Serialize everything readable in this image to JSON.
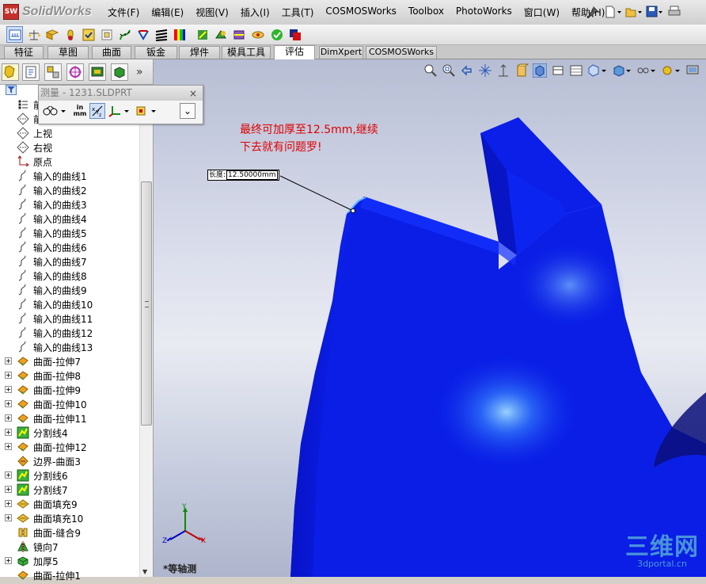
{
  "app": {
    "logo_badge": "SW",
    "logo_text": "SolidWorks"
  },
  "menu": [
    "文件(F)",
    "编辑(E)",
    "视图(V)",
    "插入(I)",
    "工具(T)",
    "COSMOSWorks",
    "Toolbox",
    "PhotoWorks",
    "窗口(W)",
    "帮助(H)"
  ],
  "menu_tools": [
    "pushpin-icon",
    "new-document-icon",
    "open-folder-icon",
    "save-icon",
    "print-icon"
  ],
  "command_toolbar": {
    "buttons": [
      "measure-icon",
      "mass-properties-icon",
      "section-properties-icon",
      "sensor-icon",
      "check-icon",
      "geometry-analysis-icon",
      "curvature-icon",
      "deviation-analysis-icon",
      "zebra-stripes-icon",
      "curvature-color-icon",
      "draft-analysis-icon",
      "undercut-icon",
      "parting-line-icon",
      "thickness-analysis-icon",
      "compare-icon",
      "error-icon"
    ],
    "active_index": 0
  },
  "tabs": [
    {
      "label": "特征",
      "selected": false
    },
    {
      "label": "草图",
      "selected": false
    },
    {
      "label": "曲面",
      "selected": false
    },
    {
      "label": "钣金",
      "selected": false
    },
    {
      "label": "焊件",
      "selected": false
    },
    {
      "label": "模具工具",
      "selected": false
    },
    {
      "label": "评估",
      "selected": true
    },
    {
      "label": "DimXpert",
      "selected": false
    },
    {
      "label": "COSMOSWorks",
      "selected": false
    }
  ],
  "panel_tabs": [
    "feature-manager-icon",
    "property-manager-icon",
    "configuration-manager-icon",
    "dimxpert-manager-icon",
    "display-manager-icon",
    "appearance-icon",
    "more-chevron-icon"
  ],
  "panel_more": "»",
  "tree": [
    {
      "label": "前",
      "icon": "sensor-folder-icon",
      "expand": false
    },
    {
      "label": "前视",
      "icon": "plane-icon",
      "expand": false
    },
    {
      "label": "上视",
      "icon": "plane-icon",
      "expand": false
    },
    {
      "label": "右视",
      "icon": "plane-icon",
      "expand": false
    },
    {
      "label": "原点",
      "icon": "origin-icon",
      "expand": false
    },
    {
      "label": "输入的曲线1",
      "icon": "curve-icon",
      "expand": false
    },
    {
      "label": "输入的曲线2",
      "icon": "curve-icon",
      "expand": false
    },
    {
      "label": "输入的曲线3",
      "icon": "curve-icon",
      "expand": false
    },
    {
      "label": "输入的曲线4",
      "icon": "curve-icon",
      "expand": false
    },
    {
      "label": "输入的曲线5",
      "icon": "curve-icon",
      "expand": false
    },
    {
      "label": "输入的曲线6",
      "icon": "curve-icon",
      "expand": false
    },
    {
      "label": "输入的曲线7",
      "icon": "curve-icon",
      "expand": false
    },
    {
      "label": "输入的曲线8",
      "icon": "curve-icon",
      "expand": false
    },
    {
      "label": "输入的曲线9",
      "icon": "curve-icon",
      "expand": false
    },
    {
      "label": "输入的曲线10",
      "icon": "curve-icon",
      "expand": false
    },
    {
      "label": "输入的曲线11",
      "icon": "curve-icon",
      "expand": false
    },
    {
      "label": "输入的曲线12",
      "icon": "curve-icon",
      "expand": false
    },
    {
      "label": "输入的曲线13",
      "icon": "curve-icon",
      "expand": false
    },
    {
      "label": "曲面-拉伸7",
      "icon": "surface-extrude-icon",
      "expand": true
    },
    {
      "label": "曲面-拉伸8",
      "icon": "surface-extrude-icon",
      "expand": true
    },
    {
      "label": "曲面-拉伸9",
      "icon": "surface-extrude-icon",
      "expand": true
    },
    {
      "label": "曲面-拉伸10",
      "icon": "surface-extrude-icon",
      "expand": true
    },
    {
      "label": "曲面-拉伸11",
      "icon": "surface-extrude-icon",
      "expand": true
    },
    {
      "label": "分割线4",
      "icon": "split-line-icon",
      "expand": true
    },
    {
      "label": "曲面-拉伸12",
      "icon": "surface-extrude-icon",
      "expand": true
    },
    {
      "label": "边界-曲面3",
      "icon": "boundary-surface-icon",
      "expand": false
    },
    {
      "label": "分割线6",
      "icon": "split-line-icon",
      "expand": true
    },
    {
      "label": "分割线7",
      "icon": "split-line-icon",
      "expand": true
    },
    {
      "label": "曲面填充9",
      "icon": "fill-surface-icon",
      "expand": true
    },
    {
      "label": "曲面填充10",
      "icon": "fill-surface-icon",
      "expand": true
    },
    {
      "label": "曲面-缝合9",
      "icon": "knit-surface-icon",
      "expand": false
    },
    {
      "label": "镜向7",
      "icon": "mirror-icon",
      "expand": false
    },
    {
      "label": "加厚5",
      "icon": "thicken-icon",
      "expand": true
    },
    {
      "label": "曲面-拉伸1",
      "icon": "surface-extrude-icon",
      "expand": false
    }
  ],
  "measure_dialog": {
    "title": "测量 - 1231.SLDPRT",
    "close": "×",
    "units_label_top": "in",
    "units_label_bottom": "mm",
    "xyz_label": "XYZ",
    "collapse": "⌄"
  },
  "view_toolbar": [
    "zoom-to-fit-icon",
    "zoom-area-icon",
    "previous-view-icon",
    "section-view-icon",
    "dynamic-annotation-icon",
    "view-orientation-icon",
    "shaded-with-edges-icon",
    "hide-lines-icon",
    "display-style-icon",
    "hide-show-items-icon",
    "edit-appearance-icon",
    "apply-scene-icon",
    "view-settings-icon",
    "monitor-icon"
  ],
  "viewport": {
    "annotation_line1": "最终可加厚至12.5mm,继续",
    "annotation_line2": "下去就有问题罗!",
    "dimension_label": "长度:",
    "dimension_value": "12.50000mm",
    "triad_x": "X",
    "triad_y": "Y",
    "triad_z": "Z",
    "view_label": "*等轴测",
    "part_color": "#0a1ee6",
    "annotation_color": "#e00000"
  },
  "watermark": {
    "big": "三维网",
    "small": "3dportal.cn"
  }
}
